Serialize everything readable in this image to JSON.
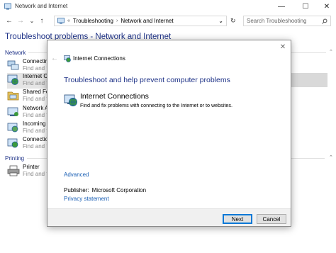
{
  "window": {
    "title": "Network and Internet",
    "controls": {
      "minimize": "—",
      "maximize": "☐",
      "close": "✕"
    }
  },
  "addressbar": {
    "back": "←",
    "forward": "→",
    "recent": "⌄",
    "up": "↑",
    "chevron": "«",
    "crumbs": [
      "Troubleshooting",
      "Network and Internet"
    ],
    "crumb_separator": "›",
    "dropdown": "⌄",
    "refresh": "↻",
    "search_placeholder": "Search Troubleshooting"
  },
  "main": {
    "heading": "Troubleshoot problems - Network and Internet",
    "groups": [
      {
        "label": "Network",
        "items": [
          {
            "title": "Connectin",
            "sub": "Find and fi"
          },
          {
            "title": "Internet Co",
            "sub": "Find and fi"
          },
          {
            "title": "Shared Fol",
            "sub": "Find and fi"
          },
          {
            "title": "Network A",
            "sub": "Find and fi"
          },
          {
            "title": "Incoming",
            "sub": "Find and fi"
          },
          {
            "title": "Connectio",
            "sub": "Find and fi"
          }
        ]
      },
      {
        "label": "Printing",
        "items": [
          {
            "title": "Printer",
            "sub": "Find and fi"
          }
        ]
      }
    ],
    "scroll_chevron": "⌃"
  },
  "dialog": {
    "close": "✕",
    "back": "←",
    "title": "Internet Connections",
    "heading": "Troubleshoot and help prevent computer problems",
    "troubleshooter": {
      "title": "Internet Connections",
      "description": "Find and fix problems with connecting to the Internet or to websites."
    },
    "advanced": "Advanced",
    "publisher_label": "Publisher:",
    "publisher_value": "Microsoft Corporation",
    "privacy": "Privacy statement",
    "next": "Next",
    "cancel": "Cancel"
  },
  "colors": {
    "heading_blue": "#1e3287",
    "link_blue": "#1a5fb4",
    "accent": "#0078d7"
  }
}
